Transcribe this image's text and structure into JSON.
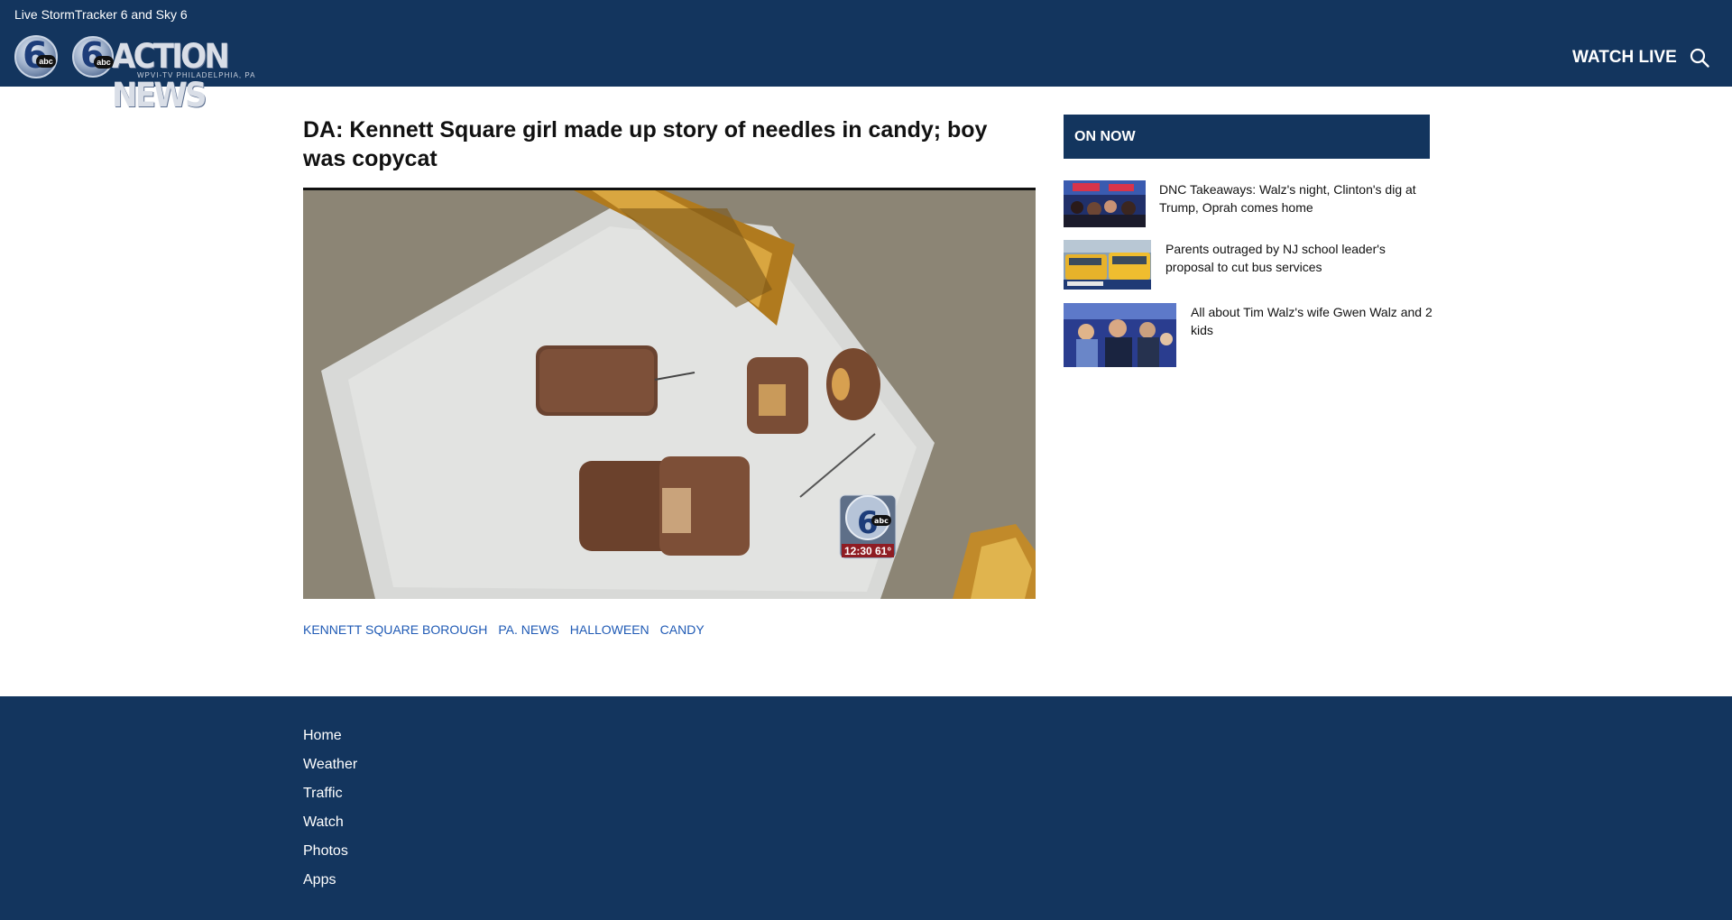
{
  "header": {
    "top_link": "Live StormTracker 6 and Sky 6",
    "logo_six": "6",
    "logo_abc": "abc",
    "brand_wordmark": "ACTION NEWS",
    "brand_sub": "WPVI-TV   PHILADELPHIA, PA",
    "watch_live": "WATCH LIVE",
    "search_icon": "search-icon"
  },
  "article": {
    "headline": "DA: Kennett Square girl made up story of needles in candy; boy was copycat",
    "hero_bug_time": "12:30",
    "hero_bug_temp": "61°",
    "tags": [
      "KENNETT SQUARE BOROUGH",
      "PA. NEWS",
      "HALLOWEEN",
      "CANDY"
    ]
  },
  "sidebar": {
    "title": "ON NOW",
    "items": [
      {
        "text": "DNC Takeaways: Walz's night, Clinton's dig at Trump, Oprah comes home"
      },
      {
        "text": "Parents outraged by NJ school leader's proposal to cut bus services"
      },
      {
        "text": "All about Tim Walz's wife Gwen Walz and 2 kids"
      }
    ]
  },
  "footer": {
    "links": [
      "Home",
      "Weather",
      "Traffic",
      "Watch",
      "Photos",
      "Apps"
    ]
  },
  "colors": {
    "brand_navy": "#13355e",
    "tag_blue": "#1f5ab5"
  }
}
